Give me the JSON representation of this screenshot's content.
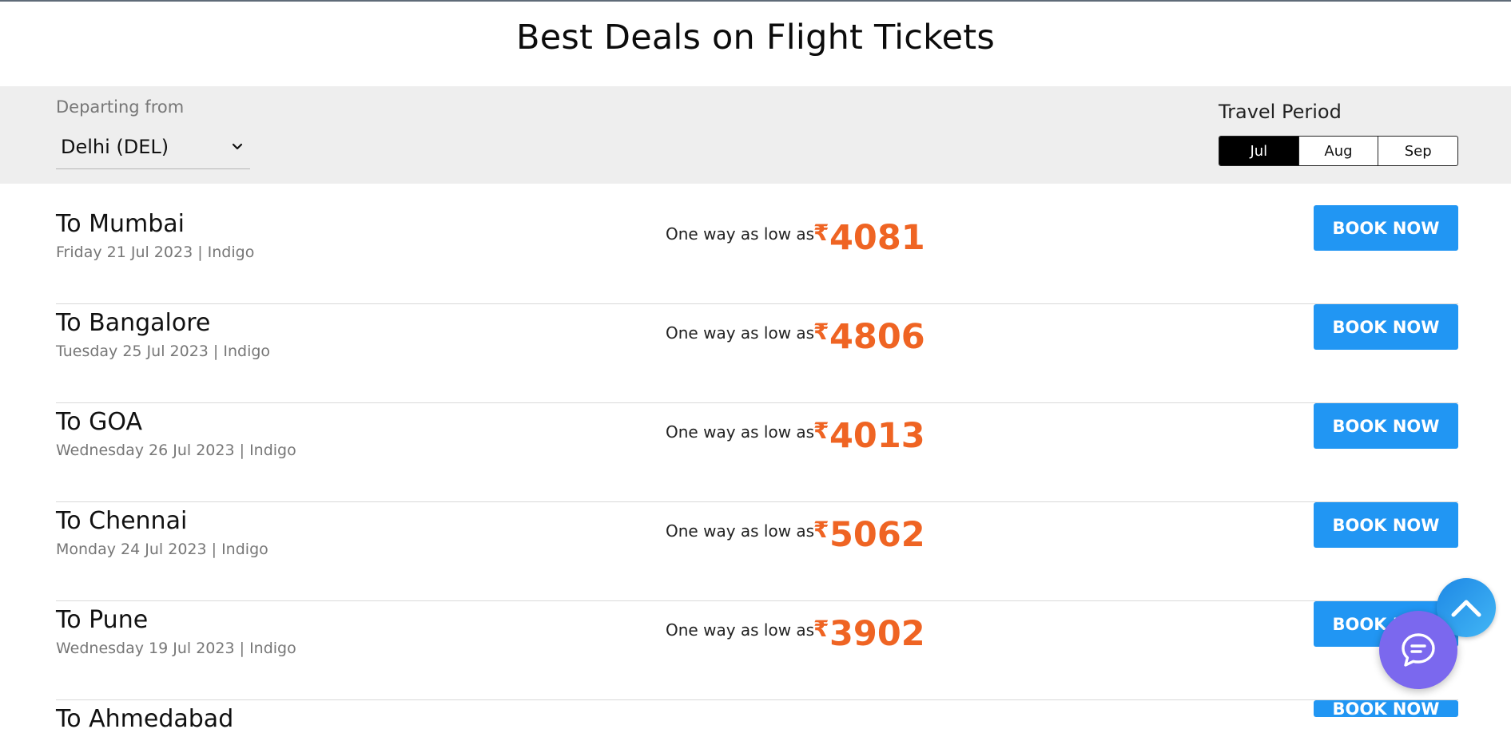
{
  "page": {
    "title": "Best Deals on Flight Tickets"
  },
  "filters": {
    "departing_label": "Departing from",
    "departing_value": "Delhi (DEL)",
    "travel_period_label": "Travel Period",
    "months": [
      "Jul",
      "Aug",
      "Sep"
    ],
    "active_month": "Jul"
  },
  "deals": [
    {
      "destination": "To Mumbai",
      "date": "Friday 21 Jul 2023",
      "airline": "Indigo",
      "low_label": "One way as low as",
      "currency": "₹",
      "price": "4081",
      "button": "BOOK NOW"
    },
    {
      "destination": "To Bangalore",
      "date": "Tuesday 25 Jul 2023",
      "airline": "Indigo",
      "low_label": "One way as low as",
      "currency": "₹",
      "price": "4806",
      "button": "BOOK NOW"
    },
    {
      "destination": "To GOA",
      "date": "Wednesday 26 Jul 2023",
      "airline": "Indigo",
      "low_label": "One way as low as",
      "currency": "₹",
      "price": "4013",
      "button": "BOOK NOW"
    },
    {
      "destination": "To Chennai",
      "date": "Monday 24 Jul 2023",
      "airline": "Indigo",
      "low_label": "One way as low as",
      "currency": "₹",
      "price": "5062",
      "button": "BOOK NOW"
    },
    {
      "destination": "To Pune",
      "date": "Wednesday 19 Jul 2023",
      "airline": "Indigo",
      "low_label": "One way as low as",
      "currency": "₹",
      "price": "3902",
      "button": "BOOK NOW"
    },
    {
      "destination": "To Ahmedabad",
      "date": "",
      "airline": "",
      "low_label": "",
      "currency": "",
      "price": "",
      "button": "BOOK NOW"
    }
  ],
  "floating": {
    "scroll_top_icon": "chevron-up-icon",
    "chat_icon": "chat-bubble-icon"
  },
  "colors": {
    "accent": "#2196f3",
    "price": "#ef6423",
    "chat": "#7b68ee"
  }
}
